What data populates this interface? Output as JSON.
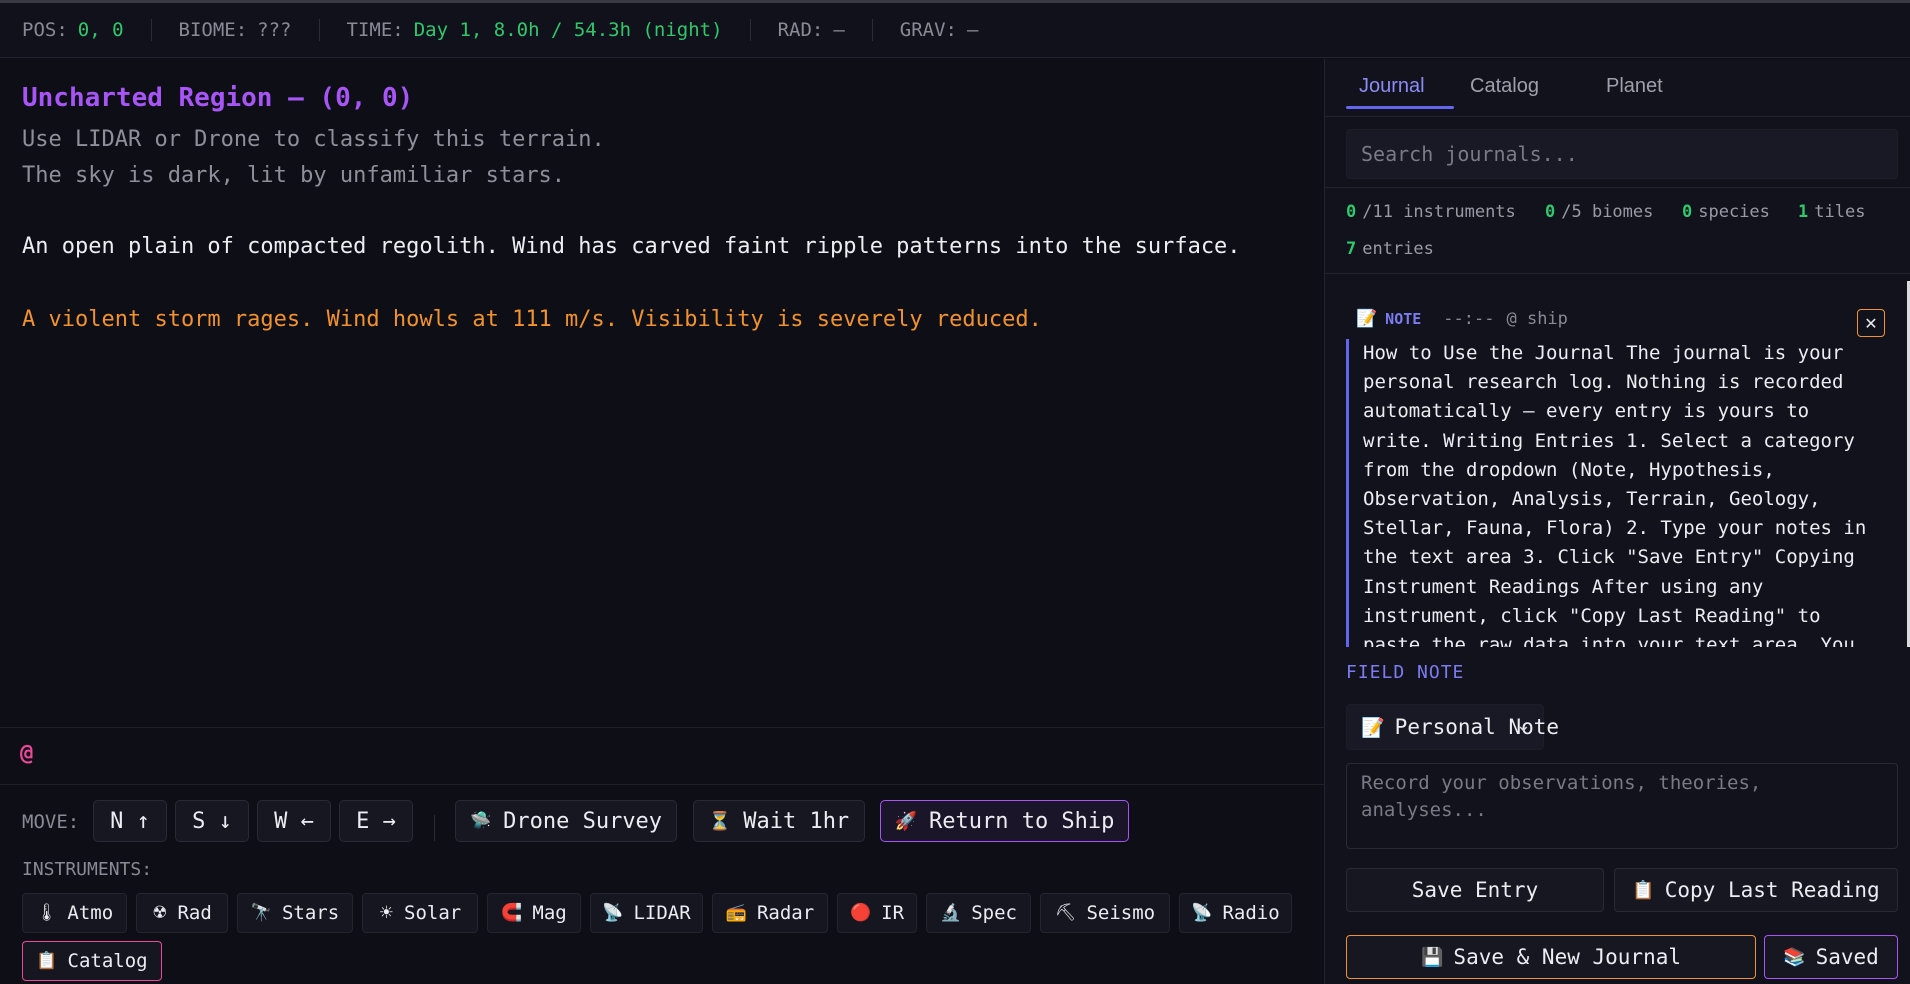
{
  "status": {
    "pos_label": "POS:",
    "pos_value": "0, 0",
    "biome_label": "BIOME:",
    "biome_value": "???",
    "time_label": "TIME:",
    "time_value": "Day 1, 8.0h / 54.3h (night)",
    "rad_label": "RAD:",
    "rad_value": "—",
    "grav_label": "GRAV:",
    "grav_value": "—"
  },
  "main": {
    "title": "Uncharted Region — (0, 0)",
    "lines": [
      "Use LIDAR or Drone to classify this terrain.",
      "The sky is dark, lit by unfamiliar stars.",
      "An open plain of compacted regolith. Wind has carved faint ripple patterns into the surface.",
      "A violent storm rages. Wind howls at 111 m/s. Visibility is severely reduced."
    ],
    "prompt": "@"
  },
  "controls": {
    "move_label": "MOVE:",
    "move": {
      "north": "N ↑",
      "south": "S ↓",
      "west": "W ←",
      "east": "E →"
    },
    "drone_survey": "Drone Survey",
    "wait": "Wait 1hr",
    "return_ship": "Return to Ship",
    "instruments_label": "INSTRUMENTS:",
    "instruments": [
      {
        "label": "Atmo",
        "icon": "thermometer-icon",
        "glyph": "🌡"
      },
      {
        "label": "Rad",
        "icon": "radiation-icon",
        "glyph": "☢"
      },
      {
        "label": "Stars",
        "icon": "telescope-icon",
        "glyph": "🔭"
      },
      {
        "label": "Solar",
        "icon": "sun-icon",
        "glyph": "☀"
      },
      {
        "label": "Mag",
        "icon": "magnet-icon",
        "glyph": "🧲"
      },
      {
        "label": "LIDAR",
        "icon": "satellite-dish-icon",
        "glyph": "📡"
      },
      {
        "label": "Radar",
        "icon": "radio-icon",
        "glyph": "📻"
      },
      {
        "label": "IR",
        "icon": "red-circle-icon",
        "glyph": "🔴"
      },
      {
        "label": "Spec",
        "icon": "microscope-icon",
        "glyph": "🔬"
      },
      {
        "label": "Seismo",
        "icon": "pickaxe-icon",
        "glyph": "⛏"
      },
      {
        "label": "Radio",
        "icon": "satellite-dish-icon",
        "glyph": "📡"
      },
      {
        "label": "Catalog",
        "icon": "clipboard-icon",
        "glyph": "📋"
      }
    ]
  },
  "journal": {
    "tabs": [
      "Journal",
      "Catalog",
      "Planet"
    ],
    "active_tab": "Journal",
    "search_placeholder": "Search journals...",
    "stats": {
      "instruments_num": "0",
      "instruments_label": "/11 instruments",
      "biomes_num": "0",
      "biomes_label": "/5 biomes",
      "species_num": "0",
      "species_label": "species",
      "tiles_num": "1",
      "tiles_label": "tiles",
      "entries_num": "7",
      "entries_label": "entries"
    },
    "entry": {
      "category": "NOTE",
      "time": "--:--",
      "location": "@ ship",
      "body": "How to Use the Journal The journal is your personal research log. Nothing is recorded automatically — every entry is yours to write. Writing Entries 1. Select a category from the dropdown (Note, Hypothesis, Observation, Analysis, Terrain, Geology, Stellar, Fauna, Flora) 2. Type your notes in the text area 3. Click \"Save Entry\" Copying Instrument Readings After using any instrument, click \"Copy Last Reading\" to paste the raw data into your text area. You"
    },
    "field_note": {
      "title": "FIELD NOTE",
      "selected_category": "Personal Note",
      "textarea_placeholder": "Record your observations, theories, analyses..."
    },
    "buttons": {
      "save_entry": "Save Entry",
      "copy_last_reading": "Copy Last Reading",
      "save_new": "Save & New Journal",
      "saved": "Saved"
    }
  },
  "colors": {
    "accent_purple": "#a855f7",
    "accent_indigo": "#6366f1",
    "success_green": "#2fc86b",
    "warning_orange": "#f2922e",
    "pink": "#ec4899"
  }
}
